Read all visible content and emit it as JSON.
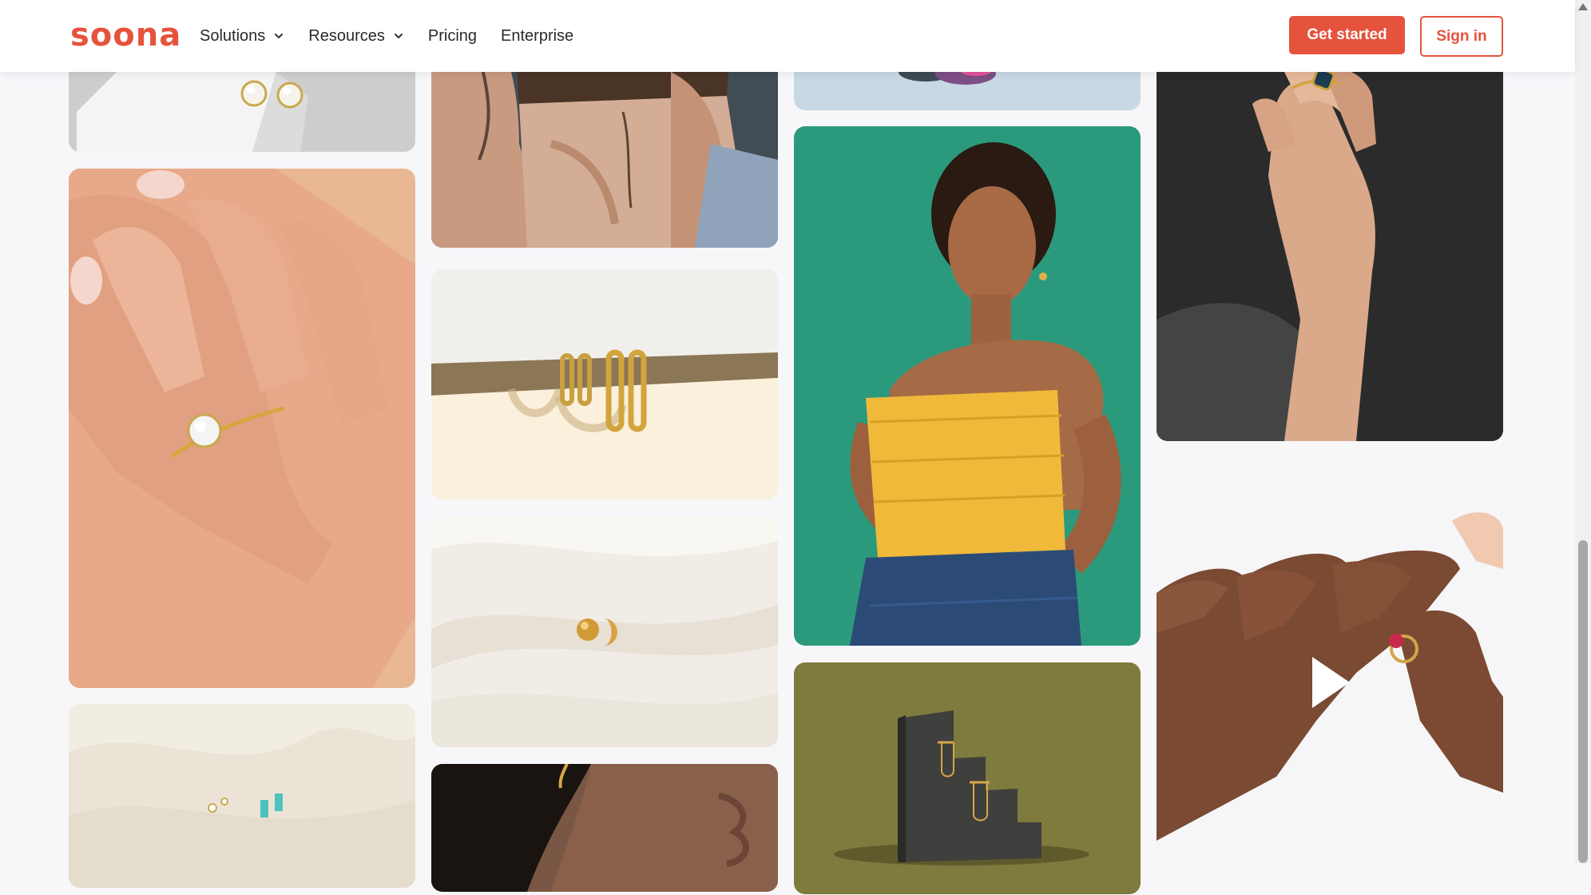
{
  "header": {
    "logo_text": "soona",
    "nav": [
      {
        "label": "Solutions",
        "has_dropdown": true
      },
      {
        "label": "Resources",
        "has_dropdown": true
      },
      {
        "label": "Pricing",
        "has_dropdown": false
      },
      {
        "label": "Enterprise",
        "has_dropdown": false
      }
    ],
    "get_started_label": "Get started",
    "sign_in_label": "Sign in"
  },
  "colors": {
    "brand": "#e5533d",
    "page_bg": "#f7f7fa"
  },
  "gallery": [
    {
      "name": "pearl-earrings-photo",
      "subject": "pearl stud earrings on white pedestal"
    },
    {
      "name": "tattooed-model-photo",
      "subject": "model with tattoos"
    },
    {
      "name": "pink-product-photo",
      "subject": "product on light blue background"
    },
    {
      "name": "hand-sapphire-ring-photo",
      "subject": "hand wearing blue gemstone ring"
    },
    {
      "name": "hand-diamond-ring-photo",
      "subject": "hand with solitaire diamond ring"
    },
    {
      "name": "hoop-earrings-photo",
      "subject": "gold hoop earrings on ledge"
    },
    {
      "name": "model-yellow-top-photo",
      "subject": "model in yellow top on green background"
    },
    {
      "name": "hand-ruby-ring-video",
      "subject": "hand holding ruby ring",
      "is_video": true
    },
    {
      "name": "gold-studs-satin-photo",
      "subject": "gold studs on white satin"
    },
    {
      "name": "drop-earrings-stand-photo",
      "subject": "gold drop earrings on stone stand"
    },
    {
      "name": "turquoise-studs-photo",
      "subject": "turquoise stud earrings on fabric"
    },
    {
      "name": "model-face-earring-photo",
      "subject": "model profile with earring"
    }
  ],
  "icons": {
    "chevron": "chevron-down-icon",
    "play": "play-icon"
  }
}
